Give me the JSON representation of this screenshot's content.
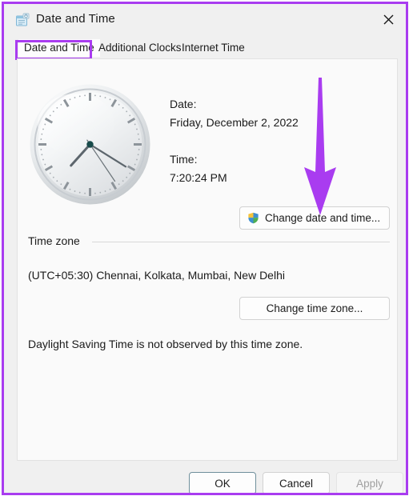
{
  "window": {
    "title": "Date and Time",
    "icon": "date-time-calendar-icon",
    "close_label": "✕",
    "annotation_color": "#a93cf0"
  },
  "tabs": [
    {
      "label": "Date and Time",
      "selected": true
    },
    {
      "label": "Additional Clocks",
      "selected": false
    },
    {
      "label": "Internet Time",
      "selected": false
    }
  ],
  "main": {
    "clock": {
      "icon": "analog-clock",
      "hour_angle": 222,
      "minute_angle": 122,
      "second_angle": 146
    },
    "date_label": "Date:",
    "date_value": "Friday, December 2, 2022",
    "time_label": "Time:",
    "time_value": "7:20:24 PM",
    "change_datetime_button": "Change date and time...",
    "change_datetime_icon": "uac-shield-icon",
    "timezone_group_label": "Time zone",
    "timezone_value": "(UTC+05:30) Chennai, Kolkata, Mumbai, New Delhi",
    "change_timezone_button": "Change time zone...",
    "dst_text": "Daylight Saving Time is not observed by this time zone."
  },
  "footer": {
    "ok_label": "OK",
    "cancel_label": "Cancel",
    "apply_label": "Apply",
    "apply_disabled": true
  }
}
